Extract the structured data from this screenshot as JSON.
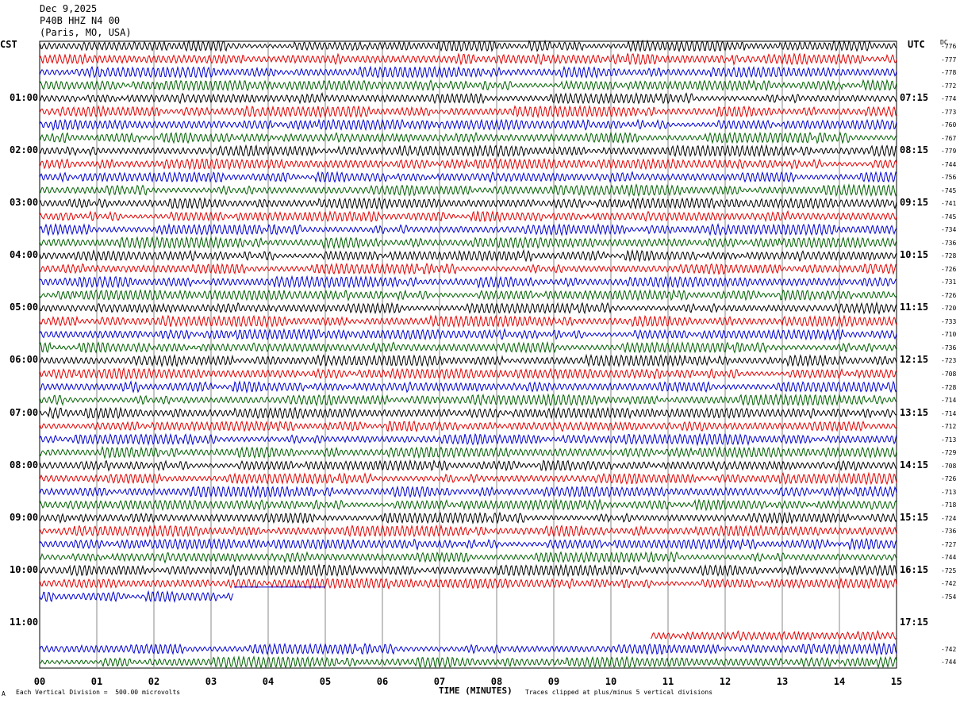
{
  "header": {
    "date": "Dec 9,2025",
    "station": "P40B HHZ N4 00",
    "location": "(Paris, MO, USA)"
  },
  "left_axis_title": "CST",
  "right_axis_title": "UTC",
  "dc_title": "DC",
  "footer": {
    "scale": "Each Vertical Division =  500.00 microvolts",
    "clip": "Traces clipped at plus/minus 5 vertical divisions",
    "mark": "A"
  },
  "chart_data": {
    "type": "line",
    "title": "",
    "xlabel": "TIME (MINUTES)",
    "xlim": [
      0,
      15
    ],
    "x_ticks": [
      "00",
      "01",
      "02",
      "03",
      "04",
      "05",
      "06",
      "07",
      "08",
      "09",
      "10",
      "11",
      "12",
      "13",
      "14",
      "15"
    ],
    "left_time_labels": [
      "01:00",
      "02:00",
      "03:00",
      "04:00",
      "05:00",
      "06:00",
      "07:00",
      "08:00",
      "09:00",
      "10:00",
      "11:00"
    ],
    "right_time_labels": [
      "07:15",
      "08:15",
      "09:15",
      "10:15",
      "11:15",
      "12:15",
      "13:15",
      "14:15",
      "15:15",
      "16:15",
      "17:15"
    ],
    "trace_colors": [
      "#000000",
      "#e00000",
      "#0000d0",
      "#006000"
    ],
    "dc_offsets": [
      "-776",
      "-777",
      "-778",
      "-772",
      "-774",
      "-773",
      "-760",
      "-767",
      "-779",
      "-744",
      "-756",
      "-745",
      "-741",
      "-745",
      "-734",
      "-736",
      "-728",
      "-726",
      "-731",
      "-726",
      "-720",
      "-733",
      "-710",
      "-736",
      "-723",
      "-708",
      "-728",
      "-714",
      "-714",
      "-712",
      "-713",
      "-729",
      "-708",
      "-726",
      "-713",
      "-718",
      "-724",
      "-736",
      "-727",
      "-744",
      "-725",
      "-742",
      "-754",
      "",
      "",
      "",
      "-742",
      "-744"
    ],
    "partial_traces": [
      {
        "row": 42,
        "data_end_minute": 3.4,
        "flat_end_minute": 5.0
      },
      {
        "row": 45,
        "data_start_minute": 10.7
      }
    ],
    "empty_rows": [
      43,
      44
    ],
    "vertical_division_microvolts": 500,
    "clip_divisions": 5
  }
}
